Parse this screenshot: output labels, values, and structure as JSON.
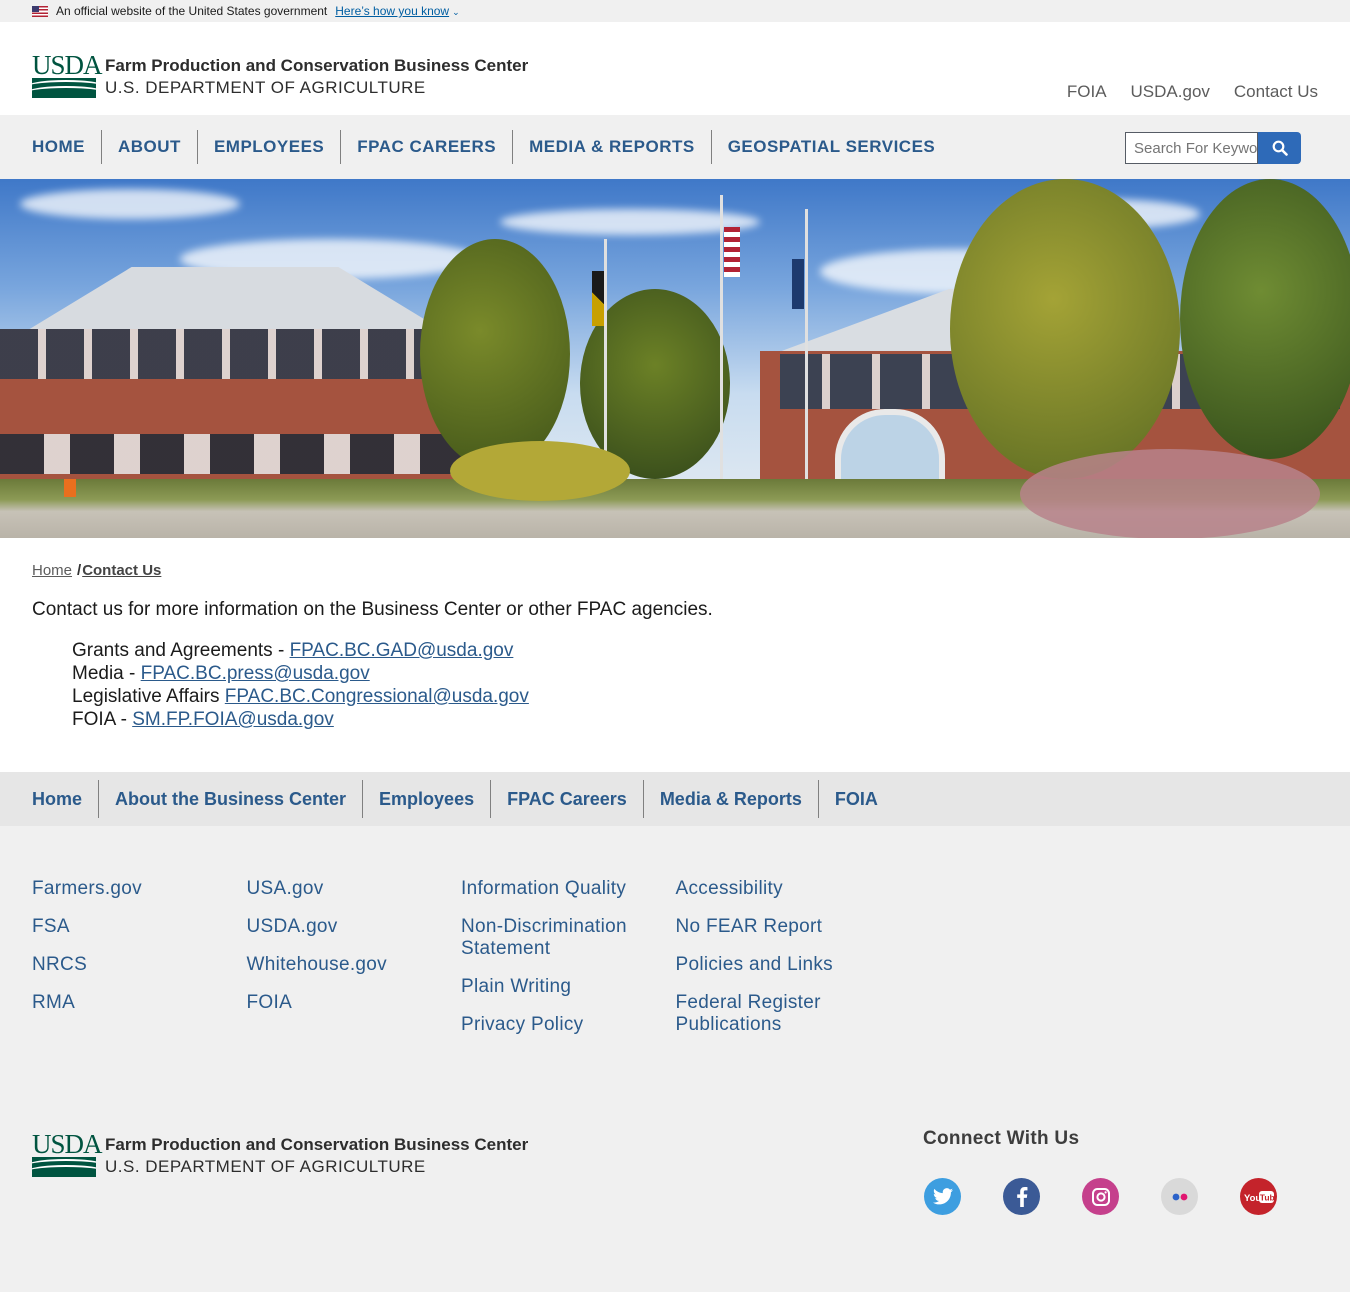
{
  "gov_banner": {
    "text": "An official website of the United States government",
    "link": "Here’s how you know"
  },
  "header": {
    "logo_mark": "USDA",
    "title": "Farm Production and Conservation Business Center",
    "subtitle": "U.S. DEPARTMENT OF AGRICULTURE",
    "util_links": [
      "FOIA",
      "USDA.gov",
      "Contact Us"
    ]
  },
  "nav": {
    "items": [
      "HOME",
      "ABOUT",
      "EMPLOYEES",
      "FPAC CAREERS",
      "MEDIA & REPORTS",
      "GEOSPATIAL SERVICES"
    ],
    "search_placeholder": "Search For Keywords"
  },
  "breadcrumb": {
    "home": "Home",
    "separator": "/",
    "current": "Contact Us"
  },
  "content": {
    "intro": "Contact us for more information on the Business Center or other FPAC agencies.",
    "contacts": [
      {
        "label": "Grants and Agreements - ",
        "email": "FPAC.BC.GAD@usda.gov"
      },
      {
        "label": "Media - ",
        "email": "FPAC.BC.press@usda.gov"
      },
      {
        "label": "Legislative Affairs ",
        "email": "FPAC.BC.Congressional@usda.gov"
      },
      {
        "label": "FOIA - ",
        "email": "SM.FP.FOIA@usda.gov"
      }
    ]
  },
  "footer_nav": [
    "Home",
    "About the Business Center",
    "Employees",
    "FPAC Careers",
    "Media & Reports",
    "FOIA"
  ],
  "footer_links": {
    "col1": [
      "Farmers.gov",
      "FSA",
      "NRCS",
      "RMA"
    ],
    "col2": [
      "USA.gov",
      "USDA.gov",
      "Whitehouse.gov",
      "FOIA"
    ],
    "col3": [
      "Information Quality",
      "Non-Discrimination Statement",
      "Plain Writing",
      "Privacy Policy"
    ],
    "col4": [
      "Accessibility",
      "No FEAR Report",
      "Policies and Links",
      "Federal Register Publications"
    ]
  },
  "footer": {
    "logo_mark": "USDA",
    "title": "Farm Production and Conservation Business Center",
    "subtitle": "U.S. DEPARTMENT OF AGRICULTURE",
    "connect_title": "Connect With Us",
    "social_icons": [
      "twitter-icon",
      "facebook-icon",
      "instagram-icon",
      "flickr-icon",
      "youtube-icon"
    ],
    "youtube_glyph": "YouTube"
  },
  "colors": {
    "link_blue": "#2b5a8b",
    "usda_green": "#005440",
    "search_button": "#2e6ab8",
    "twitter": "#3d9ee0",
    "facebook": "#3b5a96",
    "instagram": "#c5408c",
    "flickr": "#d9d9d9",
    "youtube": "#c4232b"
  }
}
